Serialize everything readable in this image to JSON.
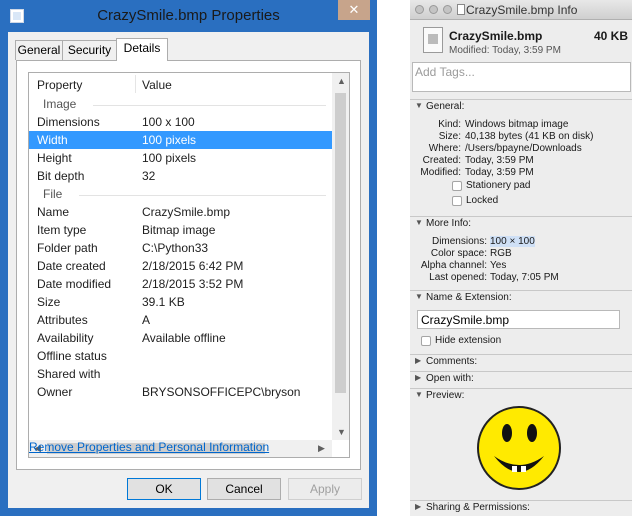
{
  "win": {
    "title": "CrazySmile.bmp Properties",
    "close_glyph": "✕",
    "tabs": [
      {
        "label": "General"
      },
      {
        "label": "Security"
      },
      {
        "label": "Details"
      }
    ],
    "columns": {
      "property": "Property",
      "value": "Value"
    },
    "groups": {
      "image": "Image",
      "file": "File"
    },
    "image_rows": [
      {
        "k": "Dimensions",
        "v": "100 x 100"
      },
      {
        "k": "Width",
        "v": "100 pixels"
      },
      {
        "k": "Height",
        "v": "100 pixels"
      },
      {
        "k": "Bit depth",
        "v": "32"
      }
    ],
    "file_rows": [
      {
        "k": "Name",
        "v": "CrazySmile.bmp"
      },
      {
        "k": "Item type",
        "v": "Bitmap image"
      },
      {
        "k": "Folder path",
        "v": "C:\\Python33"
      },
      {
        "k": "Date created",
        "v": "2/18/2015 6:42 PM"
      },
      {
        "k": "Date modified",
        "v": "2/18/2015 3:52 PM"
      },
      {
        "k": "Size",
        "v": "39.1 KB"
      },
      {
        "k": "Attributes",
        "v": "A"
      },
      {
        "k": "Availability",
        "v": "Available offline"
      },
      {
        "k": "Offline status",
        "v": ""
      },
      {
        "k": "Shared with",
        "v": ""
      },
      {
        "k": "Owner",
        "v": "BRYSONSOFFICEPC\\bryson"
      }
    ],
    "remove_link": "Remove Properties and Personal Information",
    "buttons": {
      "ok": "OK",
      "cancel": "Cancel",
      "apply": "Apply"
    }
  },
  "mac": {
    "title": "CrazySmile.bmp Info",
    "file_name": "CrazySmile.bmp",
    "file_size": "40 KB",
    "modified": "Modified: Today, 3:59 PM",
    "tags_placeholder": "Add Tags...",
    "sections": {
      "general": "General:",
      "more_info": "More Info:",
      "name_ext": "Name & Extension:",
      "comments": "Comments:",
      "open_with": "Open with:",
      "preview": "Preview:",
      "sharing": "Sharing & Permissions:"
    },
    "general": [
      {
        "k": "Kind:",
        "v": "Windows bitmap image"
      },
      {
        "k": "Size:",
        "v": "40,138 bytes (41 KB on disk)"
      },
      {
        "k": "Where:",
        "v": "/Users/bpayne/Downloads"
      },
      {
        "k": "Created:",
        "v": "Today, 3:59 PM"
      },
      {
        "k": "Modified:",
        "v": "Today, 3:59 PM"
      }
    ],
    "stationery_pad": "Stationery pad",
    "locked": "Locked",
    "more_info": [
      {
        "k": "Dimensions:",
        "v": "100 × 100"
      },
      {
        "k": "Color space:",
        "v": "RGB"
      },
      {
        "k": "Alpha channel:",
        "v": "Yes"
      },
      {
        "k": "Last opened:",
        "v": "Today, 7:05 PM"
      }
    ],
    "name_value": "CrazySmile.bmp",
    "hide_extension": "Hide extension"
  }
}
